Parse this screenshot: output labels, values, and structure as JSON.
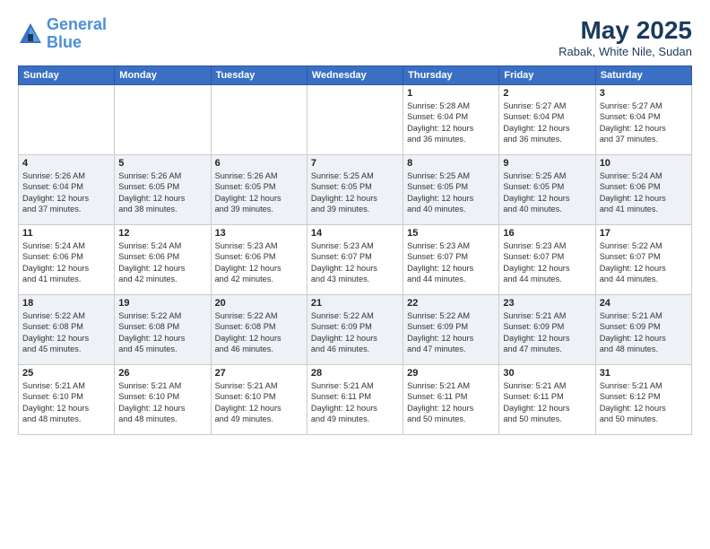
{
  "header": {
    "logo_line1": "General",
    "logo_line2": "Blue",
    "month_title": "May 2025",
    "location": "Rabak, White Nile, Sudan"
  },
  "weekdays": [
    "Sunday",
    "Monday",
    "Tuesday",
    "Wednesday",
    "Thursday",
    "Friday",
    "Saturday"
  ],
  "weeks": [
    [
      {
        "day": "",
        "info": ""
      },
      {
        "day": "",
        "info": ""
      },
      {
        "day": "",
        "info": ""
      },
      {
        "day": "",
        "info": ""
      },
      {
        "day": "1",
        "info": "Sunrise: 5:28 AM\nSunset: 6:04 PM\nDaylight: 12 hours\nand 36 minutes."
      },
      {
        "day": "2",
        "info": "Sunrise: 5:27 AM\nSunset: 6:04 PM\nDaylight: 12 hours\nand 36 minutes."
      },
      {
        "day": "3",
        "info": "Sunrise: 5:27 AM\nSunset: 6:04 PM\nDaylight: 12 hours\nand 37 minutes."
      }
    ],
    [
      {
        "day": "4",
        "info": "Sunrise: 5:26 AM\nSunset: 6:04 PM\nDaylight: 12 hours\nand 37 minutes."
      },
      {
        "day": "5",
        "info": "Sunrise: 5:26 AM\nSunset: 6:05 PM\nDaylight: 12 hours\nand 38 minutes."
      },
      {
        "day": "6",
        "info": "Sunrise: 5:26 AM\nSunset: 6:05 PM\nDaylight: 12 hours\nand 39 minutes."
      },
      {
        "day": "7",
        "info": "Sunrise: 5:25 AM\nSunset: 6:05 PM\nDaylight: 12 hours\nand 39 minutes."
      },
      {
        "day": "8",
        "info": "Sunrise: 5:25 AM\nSunset: 6:05 PM\nDaylight: 12 hours\nand 40 minutes."
      },
      {
        "day": "9",
        "info": "Sunrise: 5:25 AM\nSunset: 6:05 PM\nDaylight: 12 hours\nand 40 minutes."
      },
      {
        "day": "10",
        "info": "Sunrise: 5:24 AM\nSunset: 6:06 PM\nDaylight: 12 hours\nand 41 minutes."
      }
    ],
    [
      {
        "day": "11",
        "info": "Sunrise: 5:24 AM\nSunset: 6:06 PM\nDaylight: 12 hours\nand 41 minutes."
      },
      {
        "day": "12",
        "info": "Sunrise: 5:24 AM\nSunset: 6:06 PM\nDaylight: 12 hours\nand 42 minutes."
      },
      {
        "day": "13",
        "info": "Sunrise: 5:23 AM\nSunset: 6:06 PM\nDaylight: 12 hours\nand 42 minutes."
      },
      {
        "day": "14",
        "info": "Sunrise: 5:23 AM\nSunset: 6:07 PM\nDaylight: 12 hours\nand 43 minutes."
      },
      {
        "day": "15",
        "info": "Sunrise: 5:23 AM\nSunset: 6:07 PM\nDaylight: 12 hours\nand 44 minutes."
      },
      {
        "day": "16",
        "info": "Sunrise: 5:23 AM\nSunset: 6:07 PM\nDaylight: 12 hours\nand 44 minutes."
      },
      {
        "day": "17",
        "info": "Sunrise: 5:22 AM\nSunset: 6:07 PM\nDaylight: 12 hours\nand 44 minutes."
      }
    ],
    [
      {
        "day": "18",
        "info": "Sunrise: 5:22 AM\nSunset: 6:08 PM\nDaylight: 12 hours\nand 45 minutes."
      },
      {
        "day": "19",
        "info": "Sunrise: 5:22 AM\nSunset: 6:08 PM\nDaylight: 12 hours\nand 45 minutes."
      },
      {
        "day": "20",
        "info": "Sunrise: 5:22 AM\nSunset: 6:08 PM\nDaylight: 12 hours\nand 46 minutes."
      },
      {
        "day": "21",
        "info": "Sunrise: 5:22 AM\nSunset: 6:09 PM\nDaylight: 12 hours\nand 46 minutes."
      },
      {
        "day": "22",
        "info": "Sunrise: 5:22 AM\nSunset: 6:09 PM\nDaylight: 12 hours\nand 47 minutes."
      },
      {
        "day": "23",
        "info": "Sunrise: 5:21 AM\nSunset: 6:09 PM\nDaylight: 12 hours\nand 47 minutes."
      },
      {
        "day": "24",
        "info": "Sunrise: 5:21 AM\nSunset: 6:09 PM\nDaylight: 12 hours\nand 48 minutes."
      }
    ],
    [
      {
        "day": "25",
        "info": "Sunrise: 5:21 AM\nSunset: 6:10 PM\nDaylight: 12 hours\nand 48 minutes."
      },
      {
        "day": "26",
        "info": "Sunrise: 5:21 AM\nSunset: 6:10 PM\nDaylight: 12 hours\nand 48 minutes."
      },
      {
        "day": "27",
        "info": "Sunrise: 5:21 AM\nSunset: 6:10 PM\nDaylight: 12 hours\nand 49 minutes."
      },
      {
        "day": "28",
        "info": "Sunrise: 5:21 AM\nSunset: 6:11 PM\nDaylight: 12 hours\nand 49 minutes."
      },
      {
        "day": "29",
        "info": "Sunrise: 5:21 AM\nSunset: 6:11 PM\nDaylight: 12 hours\nand 50 minutes."
      },
      {
        "day": "30",
        "info": "Sunrise: 5:21 AM\nSunset: 6:11 PM\nDaylight: 12 hours\nand 50 minutes."
      },
      {
        "day": "31",
        "info": "Sunrise: 5:21 AM\nSunset: 6:12 PM\nDaylight: 12 hours\nand 50 minutes."
      }
    ]
  ]
}
